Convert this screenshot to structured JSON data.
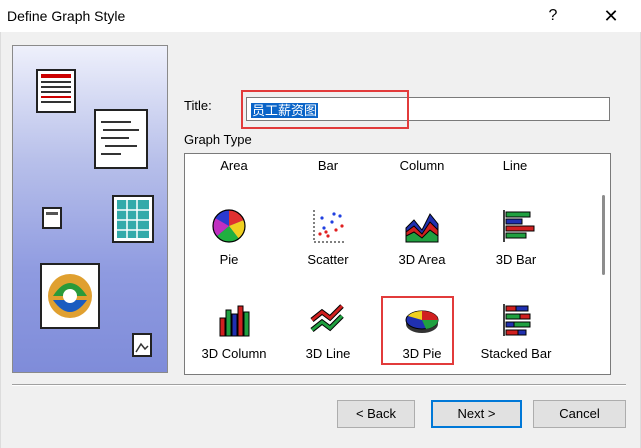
{
  "window": {
    "title": "Define Graph Style",
    "help_glyph": "?",
    "close_glyph": "✕"
  },
  "form": {
    "title_label": "Title:",
    "title_value": "员工薪资图",
    "graph_type_label": "Graph Type"
  },
  "gallery": {
    "column_headers": [
      "Area",
      "Bar",
      "Column",
      "Line"
    ],
    "items": [
      {
        "label": "Pie",
        "icon": "pie-icon"
      },
      {
        "label": "Scatter",
        "icon": "scatter-icon"
      },
      {
        "label": "3D Area",
        "icon": "3d-area-icon"
      },
      {
        "label": "3D Bar",
        "icon": "3d-bar-icon"
      },
      {
        "label": "3D Column",
        "icon": "3d-column-icon"
      },
      {
        "label": "3D Line",
        "icon": "3d-line-icon"
      },
      {
        "label": "3D Pie",
        "icon": "3d-pie-icon",
        "selected": true
      },
      {
        "label": "Stacked Bar",
        "icon": "stacked-bar-icon"
      }
    ]
  },
  "buttons": {
    "back": "< Back",
    "next": "Next >",
    "cancel": "Cancel"
  },
  "colors": {
    "highlight_red": "#e23b3b",
    "selection_blue": "#0a64c8"
  }
}
